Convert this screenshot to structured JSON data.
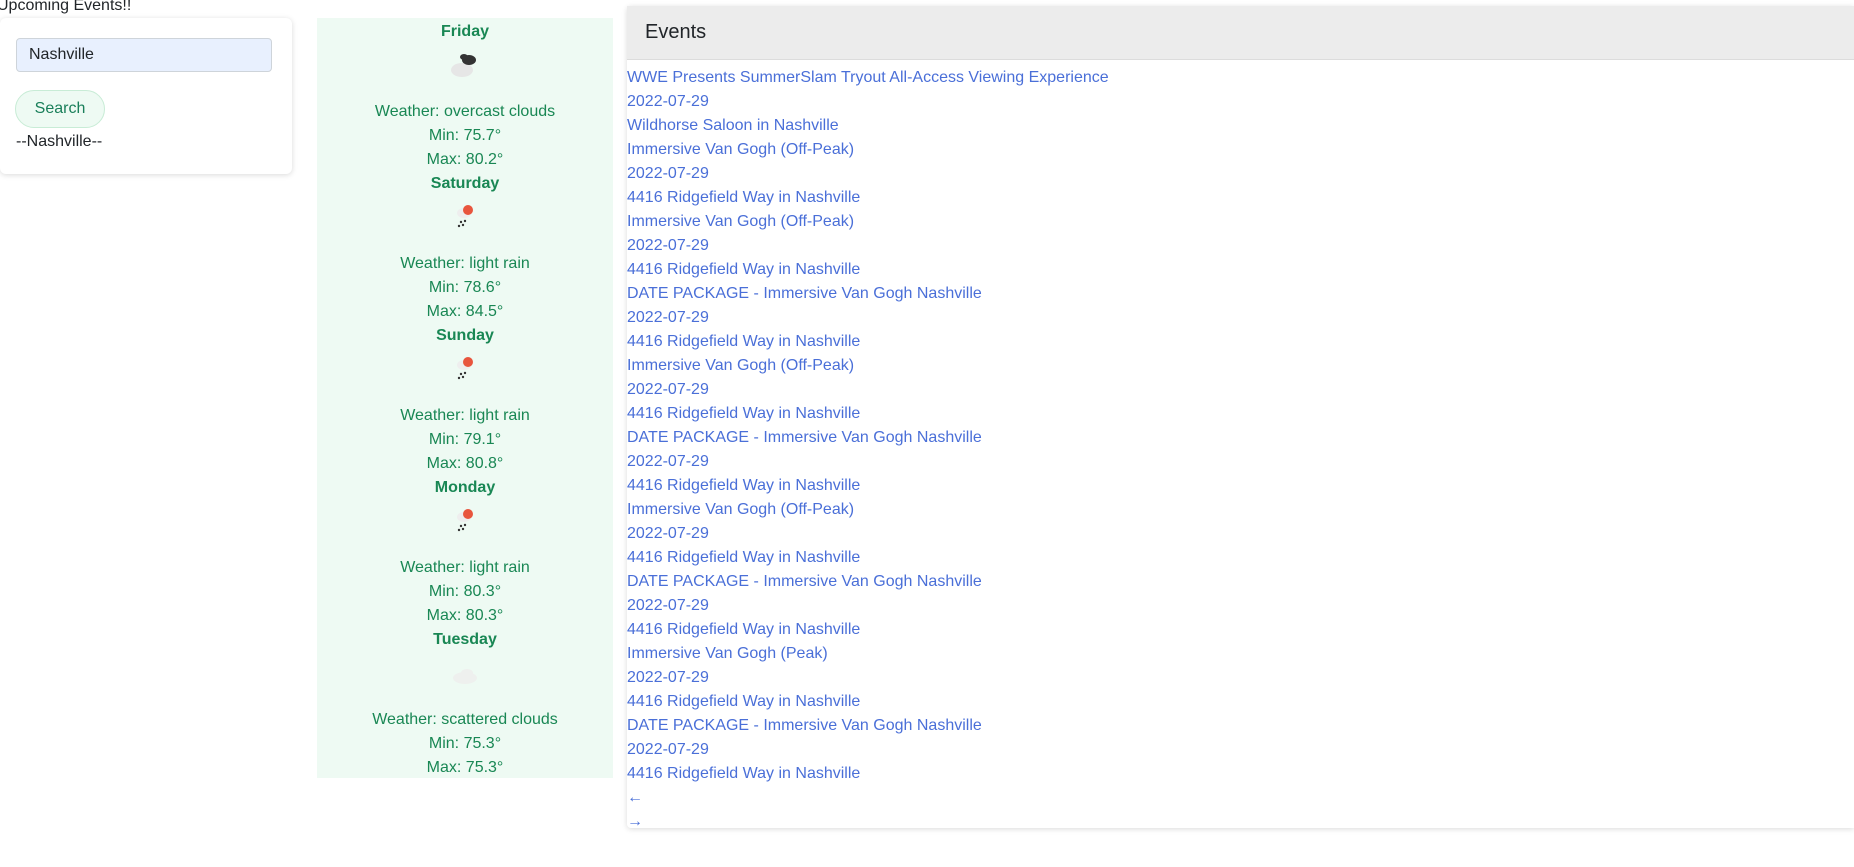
{
  "page": {
    "heading": "Upcoming Events!!"
  },
  "search": {
    "value": "Nashville",
    "button_label": "Search",
    "city_label": "--Nashville--"
  },
  "weather": [
    {
      "day": "Friday",
      "icon": "overcast-clouds-icon",
      "description": "Weather: overcast clouds",
      "min": "Min: 75.7°",
      "max": "Max: 80.2°"
    },
    {
      "day": "Saturday",
      "icon": "light-rain-icon",
      "description": "Weather: light rain",
      "min": "Min: 78.6°",
      "max": "Max: 84.5°"
    },
    {
      "day": "Sunday",
      "icon": "light-rain-icon",
      "description": "Weather: light rain",
      "min": "Min: 79.1°",
      "max": "Max: 80.8°"
    },
    {
      "day": "Monday",
      "icon": "light-rain-icon",
      "description": "Weather: light rain",
      "min": "Min: 80.3°",
      "max": "Max: 80.3°"
    },
    {
      "day": "Tuesday",
      "icon": "scattered-clouds-icon",
      "description": "Weather: scattered clouds",
      "min": "Min: 75.3°",
      "max": "Max: 75.3°"
    }
  ],
  "events": {
    "title": "Events",
    "lines": [
      "WWE Presents SummerSlam Tryout All-Access Viewing Experience",
      "2022-07-29",
      "Wildhorse Saloon in Nashville",
      "Immersive Van Gogh (Off-Peak)",
      "2022-07-29",
      "4416 Ridgefield Way in Nashville",
      "Immersive Van Gogh (Off-Peak)",
      "2022-07-29",
      "4416 Ridgefield Way in Nashville",
      "DATE PACKAGE - Immersive Van Gogh Nashville",
      "2022-07-29",
      "4416 Ridgefield Way in Nashville",
      "Immersive Van Gogh (Off-Peak)",
      "2022-07-29",
      "4416 Ridgefield Way in Nashville",
      "DATE PACKAGE - Immersive Van Gogh Nashville",
      "2022-07-29",
      "4416 Ridgefield Way in Nashville",
      "Immersive Van Gogh (Off-Peak)",
      "2022-07-29",
      "4416 Ridgefield Way in Nashville",
      "DATE PACKAGE - Immersive Van Gogh Nashville",
      "2022-07-29",
      "4416 Ridgefield Way in Nashville",
      "Immersive Van Gogh (Peak)",
      "2022-07-29",
      "4416 Ridgefield Way in Nashville",
      "DATE PACKAGE - Immersive Van Gogh Nashville",
      "2022-07-29",
      "4416 Ridgefield Way in Nashville"
    ],
    "prev_label": "←",
    "next_label": "→"
  },
  "colors": {
    "weather_bg": "#eefaf3",
    "weather_text": "#198754",
    "link": "#4a6fd8",
    "header_bg": "#ececec"
  }
}
